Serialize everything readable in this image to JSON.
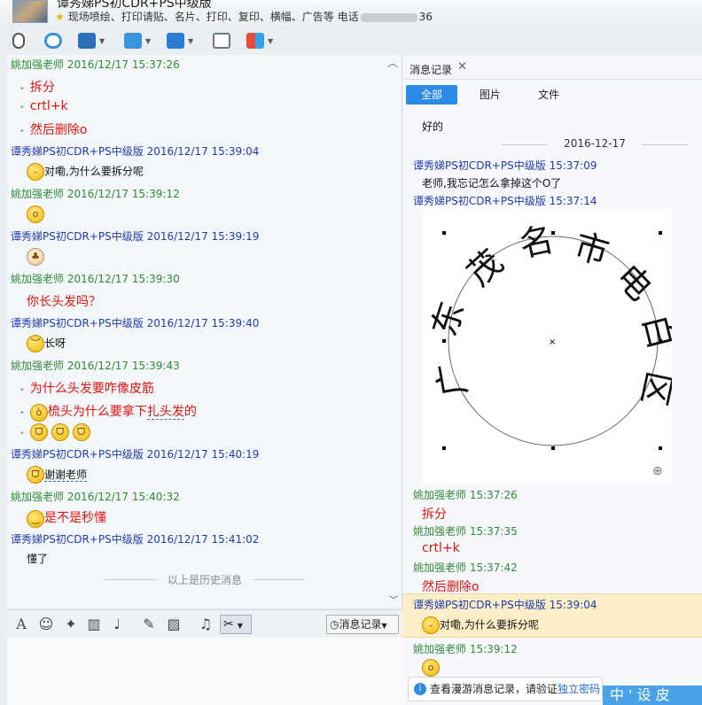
{
  "window": {
    "chat_name": "谭秀娣PS初CDR+PS中级版",
    "signature_prefix": "现场喷绘、打印请贴、名片、打印、复印、横幅、广告等   电话",
    "signature_suffix": "36"
  },
  "chat": {
    "messages": [
      {
        "sender": "姚加强老师",
        "time": "2016/12/17 15:37:26"
      },
      {
        "sender": "谭秀娣PS初CDR+PS中级版",
        "time": "2016/12/17 15:39:04"
      },
      {
        "sender": "姚加强老师",
        "time": "2016/12/17 15:39:12"
      },
      {
        "sender": "谭秀娣PS初CDR+PS中级版",
        "time": "2016/12/17 15:39:19"
      },
      {
        "sender": "姚加强老师",
        "time": "2016/12/17 15:39:30"
      },
      {
        "sender": "谭秀娣PS初CDR+PS中级版",
        "time": "2016/12/17 15:39:40"
      },
      {
        "sender": "姚加强老师",
        "time": "2016/12/17 15:39:43"
      },
      {
        "sender": "谭秀娣PS初CDR+PS中级版",
        "time": "2016/12/17 15:40:19"
      },
      {
        "sender": "姚加强老师",
        "time": "2016/12/17 15:40:32"
      },
      {
        "sender": "谭秀娣PS初CDR+PS中级版",
        "time": "2016/12/17 15:41:02"
      }
    ],
    "lines": {
      "l1": "拆分",
      "l2": "crtl+k",
      "l3": "然后删除o",
      "l4": "对嘞,为什么要拆分呢",
      "l5": "你长头发吗？",
      "l6": "长呀",
      "l7": "为什么头发要咋像皮筋",
      "l8a": "梳头为什么要拿下",
      "l8b": "扎头发",
      "l8c": "的",
      "l9": "谢谢老师",
      "l10": "是不是秒懂",
      "l11": "懂了"
    },
    "history_label": "以上是历史消息",
    "history_button": "消息记录"
  },
  "records": {
    "tab_title": "消息记录",
    "filters": [
      "全部",
      "图片",
      "文件"
    ],
    "reply_text": "好的",
    "date": "2016-12-17",
    "items": [
      {
        "sender": "谭秀娣PS初CDR+PS中级版",
        "time": "15:37:09",
        "text": "老师,我忘记怎么拿掉这个O了"
      },
      {
        "sender": "谭秀娣PS初CDR+PS中级版",
        "time": "15:37:14"
      },
      {
        "sender": "姚加强老师",
        "time": "15:37:26",
        "text": "拆分"
      },
      {
        "sender": "姚加强老师",
        "time": "15:37:35",
        "text": "crtl+k"
      },
      {
        "sender": "姚加强老师",
        "time": "15:37:42",
        "text": "然后删除o"
      },
      {
        "sender": "谭秀娣PS初CDR+PS中级版",
        "time": "15:39:04",
        "text": "对嘞,为什么要拆分呢"
      },
      {
        "sender": "姚加强老师",
        "time": "15:39:12"
      }
    ],
    "image_text_chars": [
      "广",
      "东",
      "茂",
      "名",
      "市",
      "电",
      "白",
      "区"
    ],
    "notice_prefix": "查看漫游消息记录，请验证",
    "notice_link": "独立密码",
    "ime_text": "中 ' 设 皮"
  },
  "colors": {
    "teacher": "#2f8a37",
    "student": "#1e3bb3",
    "message_red": "#e3120b",
    "accent": "#2d8ae6"
  }
}
